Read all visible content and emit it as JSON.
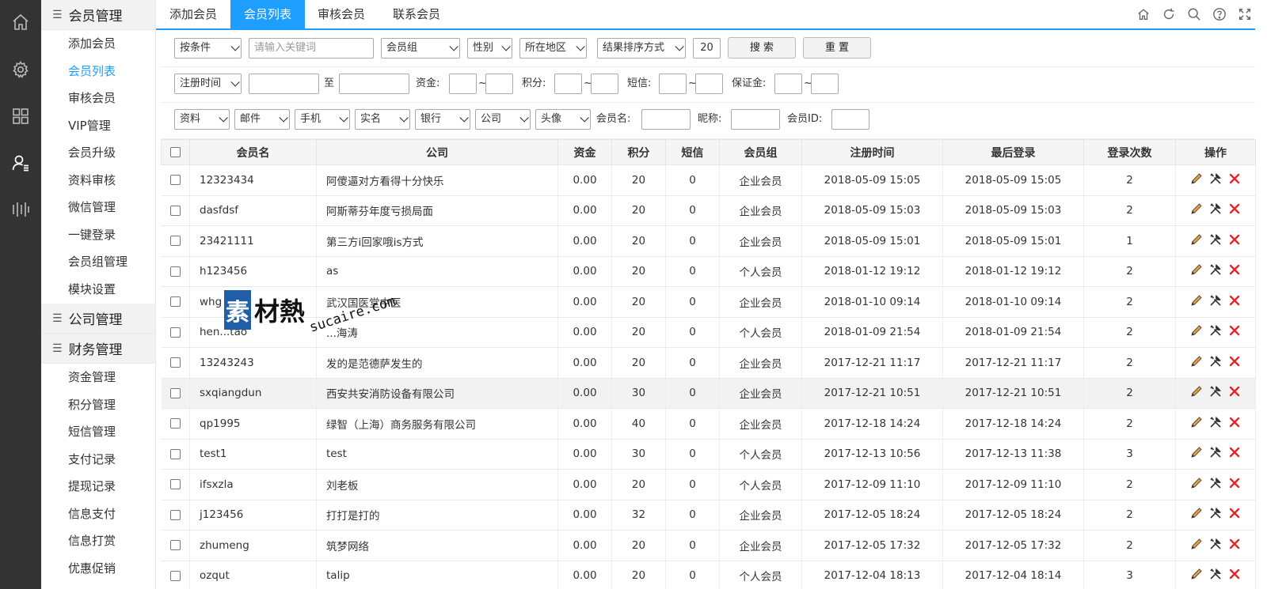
{
  "rail": {
    "icons": [
      "home-icon",
      "gear-icon",
      "grid-icon",
      "user-list-icon",
      "bars-icon"
    ]
  },
  "menu": {
    "groups": [
      {
        "label": "会员管理",
        "items": [
          "添加会员",
          "会员列表",
          "审核会员",
          "VIP管理",
          "会员升级",
          "资料审核",
          "微信管理",
          "一键登录",
          "会员组管理",
          "模块设置"
        ]
      },
      {
        "label": "公司管理",
        "items": []
      },
      {
        "label": "财务管理",
        "items": [
          "资金管理",
          "积分管理",
          "短信管理",
          "支付记录",
          "提现记录",
          "信息支付",
          "信息打赏",
          "优惠促销"
        ]
      }
    ],
    "active_item": "会员列表"
  },
  "tabs": [
    "添加会员",
    "会员列表",
    "审核会员",
    "联系会员"
  ],
  "active_tab": "会员列表",
  "toolbar_icons": [
    "home-icon",
    "refresh-icon",
    "search-icon",
    "help-icon",
    "fullscreen-icon"
  ],
  "filters": {
    "row1": {
      "condition": "按条件",
      "keyword_placeholder": "请输入关键词",
      "group": "会员组",
      "gender": "性别",
      "region": "所在地区",
      "sort": "结果排序方式",
      "page_size": "20",
      "search_label": "搜 索",
      "reset_label": "重 置"
    },
    "row2": {
      "time": "注册时间",
      "to": "至",
      "funds": "资金:",
      "points": "积分:",
      "sms": "短信:",
      "deposit": "保证金:",
      "tilde": "~"
    },
    "row3": {
      "selects": [
        "资料",
        "邮件",
        "手机",
        "实名",
        "银行",
        "公司",
        "头像"
      ],
      "member_name": "会员名:",
      "nickname": "昵称:",
      "member_id": "会员ID:"
    }
  },
  "table": {
    "columns": [
      "会员名",
      "公司",
      "资金",
      "积分",
      "短信",
      "会员组",
      "注册时间",
      "最后登录",
      "登录次数",
      "操作"
    ],
    "rows": [
      [
        "12323434",
        "阿傻逼对方看得十分快乐",
        "0.00",
        "20",
        "0",
        "企业会员",
        "2018-05-09 15:05",
        "2018-05-09 15:05",
        "2"
      ],
      [
        "dasfdsf",
        "阿斯蒂芬年度亏损局面",
        "0.00",
        "20",
        "0",
        "企业会员",
        "2018-05-09 15:03",
        "2018-05-09 15:03",
        "2"
      ],
      [
        "23421111",
        "第三方i回家哦is方式",
        "0.00",
        "20",
        "0",
        "企业会员",
        "2018-05-09 15:01",
        "2018-05-09 15:01",
        "1"
      ],
      [
        "h123456",
        "as",
        "0.00",
        "20",
        "0",
        "个人会员",
        "2018-01-12 19:12",
        "2018-01-12 19:12",
        "2"
      ],
      [
        "whg",
        "武汉国医堂中医",
        "0.00",
        "20",
        "0",
        "企业会员",
        "2018-01-10 09:14",
        "2018-01-10 09:14",
        "2"
      ],
      [
        "hen...tao",
        "...海涛",
        "0.00",
        "20",
        "0",
        "个人会员",
        "2018-01-09 21:54",
        "2018-01-09 21:54",
        "2"
      ],
      [
        "13243243",
        "发的是范德萨发生的",
        "0.00",
        "20",
        "0",
        "企业会员",
        "2017-12-21 11:17",
        "2017-12-21 11:17",
        "2"
      ],
      [
        "sxqiangdun",
        "西安共安消防设备有限公司",
        "0.00",
        "30",
        "0",
        "企业会员",
        "2017-12-21 10:51",
        "2017-12-21 10:51",
        "2"
      ],
      [
        "qp1995",
        "绿智（上海）商务服务有限公司",
        "0.00",
        "40",
        "0",
        "企业会员",
        "2017-12-18 14:24",
        "2017-12-18 14:24",
        "2"
      ],
      [
        "test1",
        "test",
        "0.00",
        "30",
        "0",
        "个人会员",
        "2017-12-13 10:56",
        "2017-12-13 11:38",
        "3"
      ],
      [
        "ifsxzla",
        "刘老板",
        "0.00",
        "20",
        "0",
        "个人会员",
        "2017-12-09 11:10",
        "2017-12-09 11:10",
        "2"
      ],
      [
        "j123456",
        "打打是打的",
        "0.00",
        "32",
        "0",
        "企业会员",
        "2017-12-05 18:24",
        "2017-12-05 18:24",
        "2"
      ],
      [
        "zhumeng",
        "筑梦网络",
        "0.00",
        "20",
        "0",
        "企业会员",
        "2017-12-05 17:32",
        "2017-12-05 17:32",
        "2"
      ],
      [
        "ozqut",
        "talip",
        "0.00",
        "20",
        "0",
        "个人会员",
        "2017-12-04 18:13",
        "2017-12-04 18:14",
        "3"
      ]
    ],
    "highlight_row": 7,
    "row_actions": [
      "edit-icon",
      "tools-icon",
      "delete-icon"
    ]
  },
  "watermark": {
    "text_cn": "素材熱",
    "text_en": "sucaire.com"
  },
  "colors": {
    "accent": "#1e9fff",
    "rail_bg": "#333333",
    "delete": "#e4262b"
  }
}
